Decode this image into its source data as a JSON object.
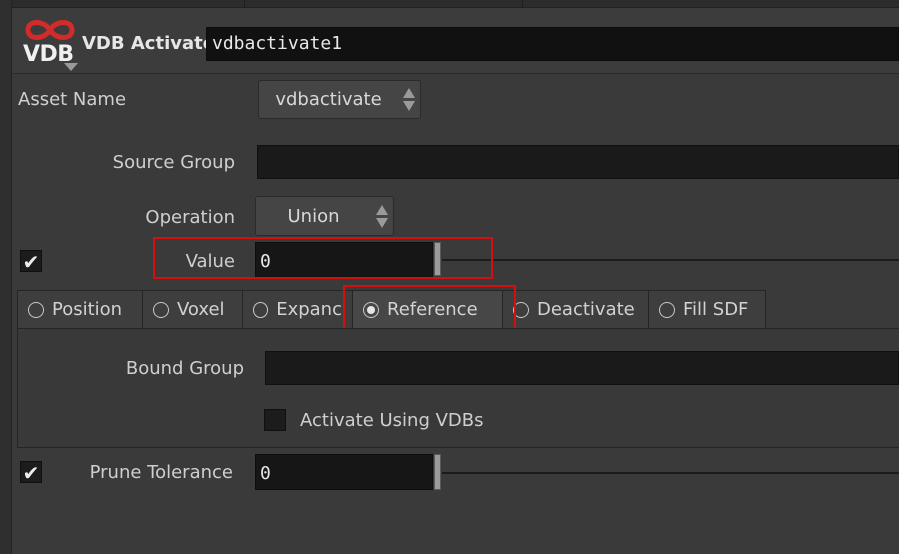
{
  "header": {
    "logo_text": "VDB",
    "node_type": "VDB Activate",
    "node_name": "vdbactivate1"
  },
  "asset_name": {
    "label": "Asset Name",
    "value": "vdbactivate"
  },
  "source_group": {
    "label": "Source Group",
    "value": ""
  },
  "operation": {
    "label": "Operation",
    "value": "Union"
  },
  "value_param": {
    "label": "Value",
    "value": "0",
    "enabled": true
  },
  "tabs": [
    {
      "label": "Position",
      "selected": false
    },
    {
      "label": "Voxel",
      "selected": false
    },
    {
      "label": "Expanc",
      "selected": false
    },
    {
      "label": "Reference",
      "selected": true
    },
    {
      "label": "Deactivate",
      "selected": false
    },
    {
      "label": "Fill SDF",
      "selected": false
    }
  ],
  "reference_panel": {
    "bound_group_label": "Bound Group",
    "bound_group_value": "",
    "activate_using_vdbs_label": "Activate Using VDBs",
    "activate_using_vdbs_checked": false
  },
  "prune_tolerance": {
    "label": "Prune Tolerance",
    "value": "0",
    "enabled": true
  },
  "colors": {
    "highlight": "#d40f0f",
    "logo_red": "#d32a2a",
    "background": "#3a3a3a"
  }
}
